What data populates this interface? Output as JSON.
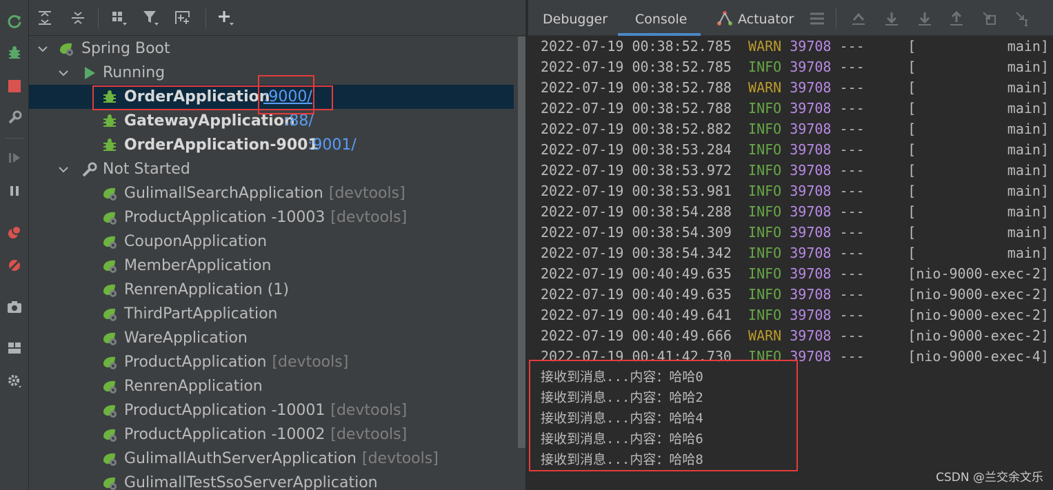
{
  "tree": {
    "root": "Spring Boot",
    "running_group": "Running",
    "running": [
      {
        "name": "OrderApplication",
        "port": ":9000/"
      },
      {
        "name": "GatewayApplication",
        "port": ":88/"
      },
      {
        "name": "OrderApplication-9001",
        "port": ":9001/"
      }
    ],
    "not_started_group": "Not Started",
    "not_started": [
      {
        "name": "GulimallSearchApplication",
        "tag": "[devtools]"
      },
      {
        "name": "ProductApplication -10003",
        "tag": "[devtools]"
      },
      {
        "name": "CouponApplication",
        "tag": ""
      },
      {
        "name": "MemberApplication",
        "tag": ""
      },
      {
        "name": "RenrenApplication (1)",
        "tag": ""
      },
      {
        "name": "ThirdPartApplication",
        "tag": ""
      },
      {
        "name": "WareApplication",
        "tag": ""
      },
      {
        "name": "ProductApplication",
        "tag": "[devtools]"
      },
      {
        "name": "RenrenApplication",
        "tag": ""
      },
      {
        "name": "ProductApplication -10001",
        "tag": "[devtools]"
      },
      {
        "name": "ProductApplication -10002",
        "tag": "[devtools]"
      },
      {
        "name": "GulimallAuthServerApplication",
        "tag": "[devtools]"
      },
      {
        "name": "GulimallTestSsoServerApplication",
        "tag": ""
      }
    ]
  },
  "tabs": {
    "debugger": "Debugger",
    "console": "Console",
    "actuator": "Actuator"
  },
  "log": {
    "pid": "39708",
    "sep": "---",
    "lines": [
      {
        "ts": "2022-07-19 00:38:52.785",
        "level": "WARN",
        "thread": "[           main]"
      },
      {
        "ts": "2022-07-19 00:38:52.785",
        "level": "INFO",
        "thread": "[           main]"
      },
      {
        "ts": "2022-07-19 00:38:52.788",
        "level": "WARN",
        "thread": "[           main]"
      },
      {
        "ts": "2022-07-19 00:38:52.788",
        "level": "INFO",
        "thread": "[           main]"
      },
      {
        "ts": "2022-07-19 00:38:52.882",
        "level": "INFO",
        "thread": "[           main]"
      },
      {
        "ts": "2022-07-19 00:38:53.284",
        "level": "INFO",
        "thread": "[           main]"
      },
      {
        "ts": "2022-07-19 00:38:53.972",
        "level": "INFO",
        "thread": "[           main]"
      },
      {
        "ts": "2022-07-19 00:38:53.981",
        "level": "INFO",
        "thread": "[           main]"
      },
      {
        "ts": "2022-07-19 00:38:54.288",
        "level": "INFO",
        "thread": "[           main]"
      },
      {
        "ts": "2022-07-19 00:38:54.309",
        "level": "INFO",
        "thread": "[           main]"
      },
      {
        "ts": "2022-07-19 00:38:54.342",
        "level": "INFO",
        "thread": "[           main]"
      },
      {
        "ts": "2022-07-19 00:40:49.635",
        "level": "INFO",
        "thread": "[nio-9000-exec-2]"
      },
      {
        "ts": "2022-07-19 00:40:49.635",
        "level": "INFO",
        "thread": "[nio-9000-exec-2]"
      },
      {
        "ts": "2022-07-19 00:40:49.641",
        "level": "INFO",
        "thread": "[nio-9000-exec-2]"
      },
      {
        "ts": "2022-07-19 00:40:49.666",
        "level": "WARN",
        "thread": "[nio-9000-exec-2]"
      },
      {
        "ts": "2022-07-19 00:41:42.730",
        "level": "INFO",
        "thread": "[nio-9000-exec-4]"
      }
    ],
    "messages": [
      "接收到消息...内容：哈哈0",
      "接收到消息...内容：哈哈2",
      "接收到消息...内容：哈哈4",
      "接收到消息...内容：哈哈6",
      "接收到消息...内容：哈哈8"
    ]
  },
  "watermark": "CSDN @兰交余文乐",
  "colors": {
    "warn": "#bb9a2c",
    "info": "#67a646",
    "pid": "#b98ae6",
    "link": "#589df6",
    "highlight_box": "#e53b3b",
    "spring_green": "#6db33f"
  }
}
